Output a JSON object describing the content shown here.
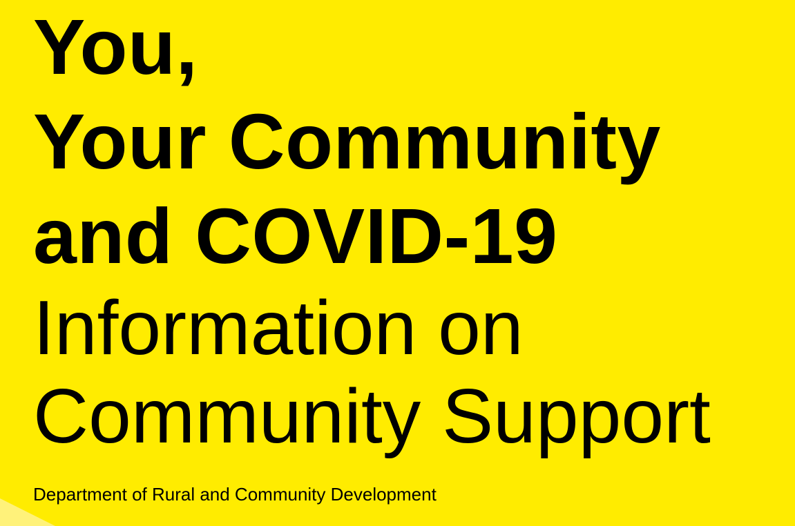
{
  "title": {
    "line1": "You,",
    "line2": "Your Community",
    "line3": "and COVID-19"
  },
  "subtitle": {
    "line1": "Information on",
    "line2": "Community Support"
  },
  "footer": {
    "department": "Department of Rural and Community Development"
  },
  "colors": {
    "background": "#ffec00",
    "text": "#000000",
    "corner_accent": "#fff27a"
  }
}
